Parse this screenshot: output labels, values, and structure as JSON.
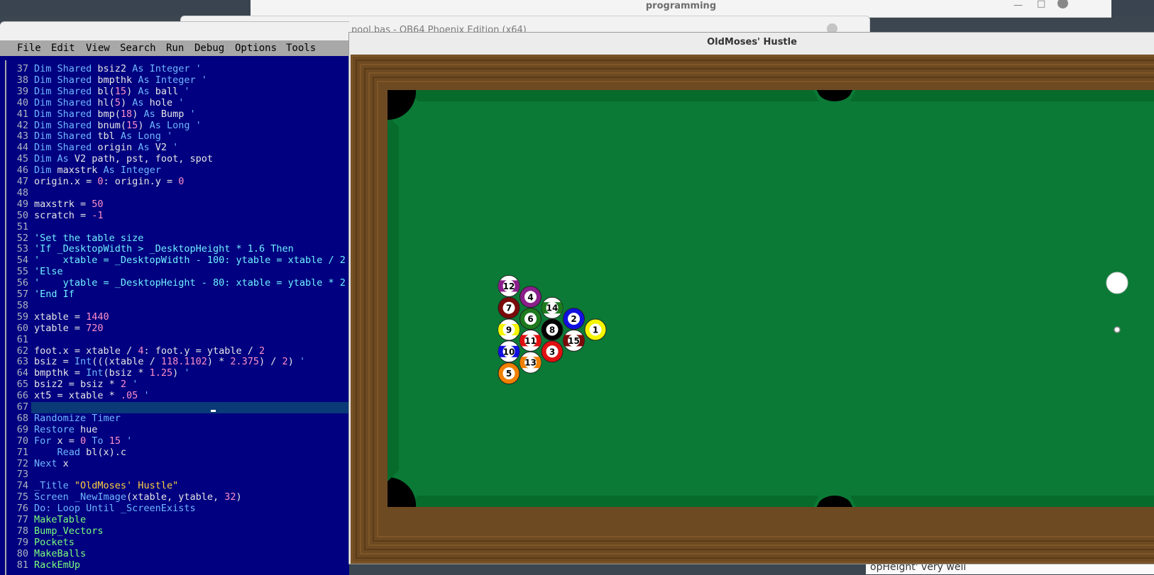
{
  "background": {
    "programming_window_title": "programming",
    "editor_window_title": "pool.bas - QB64 Phoenix Edition (x64)",
    "bottom_text": "opHeight' very well"
  },
  "ide": {
    "menu": [
      "File",
      "Edit",
      "View",
      "Search",
      "Run",
      "Debug",
      "Options",
      "Tools"
    ],
    "lines": [
      {
        "n": "37",
        "t": [
          [
            "kw",
            "Dim Shared "
          ],
          [
            "",
            "bsiz2 "
          ],
          [
            "kw",
            "As Integer "
          ],
          [
            "kw",
            "'"
          ]
        ]
      },
      {
        "n": "38",
        "t": [
          [
            "kw",
            "Dim Shared "
          ],
          [
            "",
            "bmpthk "
          ],
          [
            "kw",
            "As Integer "
          ],
          [
            "kw",
            "'"
          ]
        ]
      },
      {
        "n": "39",
        "t": [
          [
            "kw",
            "Dim Shared "
          ],
          [
            "",
            "bl("
          ],
          [
            "num",
            "15"
          ],
          [
            "",
            ") "
          ],
          [
            "kw",
            "As "
          ],
          [
            "",
            "ball "
          ],
          [
            "kw",
            "'"
          ]
        ]
      },
      {
        "n": "40",
        "t": [
          [
            "kw",
            "Dim Shared "
          ],
          [
            "",
            "hl("
          ],
          [
            "num",
            "5"
          ],
          [
            "",
            ") "
          ],
          [
            "kw",
            "As "
          ],
          [
            "",
            "hole "
          ],
          [
            "kw",
            "'"
          ]
        ]
      },
      {
        "n": "41",
        "t": [
          [
            "kw",
            "Dim Shared "
          ],
          [
            "",
            "bmp("
          ],
          [
            "num",
            "18"
          ],
          [
            "",
            ") "
          ],
          [
            "kw",
            "As "
          ],
          [
            "",
            "Bump "
          ],
          [
            "kw",
            "'"
          ]
        ]
      },
      {
        "n": "42",
        "t": [
          [
            "kw",
            "Dim Shared "
          ],
          [
            "",
            "bnum("
          ],
          [
            "num",
            "15"
          ],
          [
            "",
            ") "
          ],
          [
            "kw",
            "As Long "
          ],
          [
            "kw",
            "'"
          ]
        ]
      },
      {
        "n": "43",
        "t": [
          [
            "kw",
            "Dim Shared "
          ],
          [
            "",
            "tbl "
          ],
          [
            "kw",
            "As Long "
          ],
          [
            "kw",
            "'"
          ]
        ]
      },
      {
        "n": "44",
        "t": [
          [
            "kw",
            "Dim Shared "
          ],
          [
            "",
            "origin "
          ],
          [
            "kw",
            "As "
          ],
          [
            "",
            "V2 "
          ],
          [
            "kw",
            "'"
          ]
        ]
      },
      {
        "n": "45",
        "t": [
          [
            "kw",
            "Dim As "
          ],
          [
            "",
            "V2 path, pst, foot, spot"
          ]
        ]
      },
      {
        "n": "46",
        "t": [
          [
            "kw",
            "Dim "
          ],
          [
            "",
            "maxstrk "
          ],
          [
            "kw",
            "As Integer"
          ]
        ]
      },
      {
        "n": "47",
        "t": [
          [
            "",
            "origin.x = "
          ],
          [
            "num",
            "0"
          ],
          [
            "",
            ": origin.y = "
          ],
          [
            "num",
            "0"
          ]
        ]
      },
      {
        "n": "48",
        "t": []
      },
      {
        "n": "49",
        "t": [
          [
            "",
            "maxstrk = "
          ],
          [
            "num",
            "50"
          ]
        ]
      },
      {
        "n": "50",
        "t": [
          [
            "",
            "scratch = "
          ],
          [
            "num",
            "-1"
          ]
        ]
      },
      {
        "n": "51",
        "t": []
      },
      {
        "n": "52",
        "t": [
          [
            "cm",
            "'Set the table size"
          ]
        ]
      },
      {
        "n": "53",
        "t": [
          [
            "cm",
            "'If _DesktopWidth > _DesktopHeight * 1.6 Then"
          ]
        ]
      },
      {
        "n": "54",
        "t": [
          [
            "cm",
            "'    xtable = _DesktopWidth - 100: ytable = xtable / 2"
          ]
        ]
      },
      {
        "n": "55",
        "t": [
          [
            "cm",
            "'Else"
          ]
        ]
      },
      {
        "n": "56",
        "t": [
          [
            "cm",
            "'    ytable = _DesktopHeight - 80: xtable = ytable * 2"
          ]
        ]
      },
      {
        "n": "57",
        "t": [
          [
            "cm",
            "'End If"
          ]
        ]
      },
      {
        "n": "58",
        "t": []
      },
      {
        "n": "59",
        "t": [
          [
            "",
            "xtable = "
          ],
          [
            "num",
            "1440"
          ]
        ]
      },
      {
        "n": "60",
        "t": [
          [
            "",
            "ytable = "
          ],
          [
            "num",
            "720"
          ]
        ]
      },
      {
        "n": "61",
        "t": []
      },
      {
        "n": "62",
        "t": [
          [
            "",
            "foot.x = xtable / "
          ],
          [
            "num",
            "4"
          ],
          [
            "",
            ": foot.y = ytable / "
          ],
          [
            "num",
            "2"
          ]
        ]
      },
      {
        "n": "63",
        "t": [
          [
            "",
            "bsiz = "
          ],
          [
            "kw",
            "Int"
          ],
          [
            "",
            "(((xtable / "
          ],
          [
            "num",
            "118.1102"
          ],
          [
            "",
            ") * "
          ],
          [
            "num",
            "2.375"
          ],
          [
            "",
            ") / "
          ],
          [
            "num",
            "2"
          ],
          [
            "",
            ") "
          ],
          [
            "kw",
            "'"
          ]
        ]
      },
      {
        "n": "64",
        "t": [
          [
            "",
            "bmpthk = "
          ],
          [
            "kw",
            "Int"
          ],
          [
            "",
            "(bsiz * "
          ],
          [
            "num",
            "1.25"
          ],
          [
            "",
            ") "
          ],
          [
            "kw",
            "'"
          ]
        ]
      },
      {
        "n": "65",
        "t": [
          [
            "",
            "bsiz2 = bsiz * "
          ],
          [
            "num",
            "2"
          ],
          [
            "kw",
            " '"
          ]
        ]
      },
      {
        "n": "66",
        "t": [
          [
            "",
            "xt5 = xtable * "
          ],
          [
            "num",
            ".05"
          ],
          [
            "kw",
            " '"
          ]
        ]
      },
      {
        "n": "67",
        "t": []
      },
      {
        "n": "68",
        "t": [
          [
            "kw",
            "Randomize Timer"
          ]
        ]
      },
      {
        "n": "69",
        "t": [
          [
            "kw",
            "Restore "
          ],
          [
            "",
            "hue"
          ]
        ]
      },
      {
        "n": "70",
        "t": [
          [
            "kw",
            "For "
          ],
          [
            "",
            "x = "
          ],
          [
            "num",
            "0"
          ],
          [
            "kw",
            " To "
          ],
          [
            "num",
            "15"
          ],
          [
            "kw",
            " '"
          ]
        ]
      },
      {
        "n": "71",
        "t": [
          [
            "kw",
            "    Read "
          ],
          [
            "",
            "bl(x).c"
          ]
        ]
      },
      {
        "n": "72",
        "t": [
          [
            "kw",
            "Next "
          ],
          [
            "",
            "x"
          ]
        ]
      },
      {
        "n": "73",
        "t": []
      },
      {
        "n": "74",
        "t": [
          [
            "kw",
            "_Title "
          ],
          [
            "ss",
            "\"OldMoses' Hustle\""
          ]
        ]
      },
      {
        "n": "75",
        "t": [
          [
            "kw",
            "Screen _NewImage"
          ],
          [
            "",
            "(xtable, ytable, "
          ],
          [
            "num",
            "32"
          ],
          [
            "",
            ")"
          ]
        ]
      },
      {
        "n": "76",
        "t": [
          [
            "kw",
            "Do: Loop Until _ScreenExists"
          ]
        ]
      },
      {
        "n": "77",
        "t": [
          [
            "fn",
            "MakeTable"
          ]
        ]
      },
      {
        "n": "78",
        "t": [
          [
            "fn",
            "Bump_Vectors"
          ]
        ]
      },
      {
        "n": "79",
        "t": [
          [
            "fn",
            "Pockets"
          ]
        ]
      },
      {
        "n": "80",
        "t": [
          [
            "fn",
            "MakeBalls"
          ]
        ]
      },
      {
        "n": "81",
        "t": [
          [
            "fn",
            "RackEmUp"
          ]
        ]
      }
    ]
  },
  "game": {
    "title": "OldMoses' Hustle",
    "balls": [
      {
        "num": "12",
        "color": "#8a1f8a",
        "stripe": true
      },
      {
        "num": "4",
        "color": "#8a1f8a",
        "stripe": false
      },
      {
        "num": "14",
        "color": "#1d7a1d",
        "stripe": true
      },
      {
        "num": "7",
        "color": "#7a0a0a",
        "stripe": false
      },
      {
        "num": "6",
        "color": "#1d7a1d",
        "stripe": false
      },
      {
        "num": "2",
        "color": "#1010e0",
        "stripe": false
      },
      {
        "num": "9",
        "color": "#f5f500",
        "stripe": true
      },
      {
        "num": "8",
        "color": "#000000",
        "stripe": false
      },
      {
        "num": "1",
        "color": "#f5f500",
        "stripe": false
      },
      {
        "num": "11",
        "color": "#e01010",
        "stripe": true
      },
      {
        "num": "15",
        "color": "#7a0a0a",
        "stripe": true
      },
      {
        "num": "10",
        "color": "#1010e0",
        "stripe": true
      },
      {
        "num": "3",
        "color": "#e01010",
        "stripe": false
      },
      {
        "num": "13",
        "color": "#f08000",
        "stripe": true
      },
      {
        "num": "5",
        "color": "#f08000",
        "stripe": false
      }
    ],
    "colors": {
      "felt": "#0b7a36",
      "cushion": "#076b2c",
      "rail": "#6e4a22",
      "pocket": "#000000"
    }
  }
}
